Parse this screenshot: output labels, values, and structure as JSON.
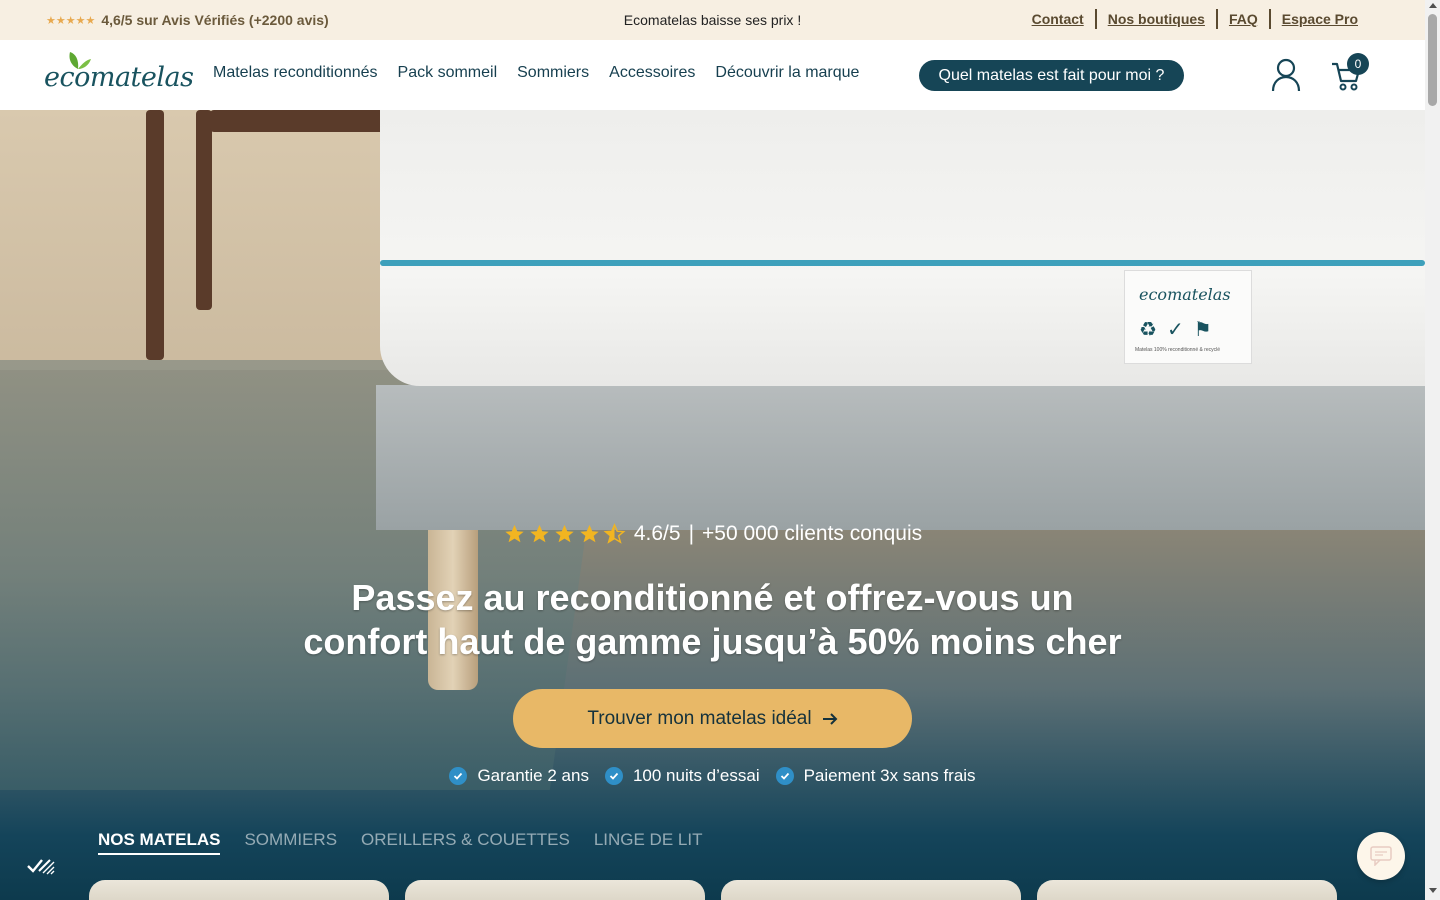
{
  "topbar": {
    "stars": "★★★★★",
    "rating_text": "4,6/5 sur Avis Vérifiés (+2200 avis)",
    "promo": "Ecomatelas baisse ses prix !",
    "links": [
      "Contact",
      "Nos boutiques",
      "FAQ",
      "Espace Pro"
    ]
  },
  "header": {
    "logo_text": "ecomatelas",
    "nav": [
      "Matelas reconditionnés",
      "Pack sommeil",
      "Sommiers",
      "Accessoires",
      "Découvrir la marque"
    ],
    "quiz_button": "Quel matelas est fait pour moi ?",
    "cart_count": "0"
  },
  "hero": {
    "mattress_label_brand": "ecomatelas",
    "mattress_label_fine": "Matelas 100% reconditionné & recyclé",
    "rating_value": "4.6/5",
    "rating_separator": "|",
    "rating_clients": "+50 000 clients conquis",
    "stars_value": 4.5,
    "title_line1": "Passez au reconditionné et offrez-vous un",
    "title_line2": "confort haut de gamme jusqu’à 50% moins cher",
    "cta": "Trouver mon matelas idéal",
    "guarantees": [
      "Garantie 2 ans",
      "100 nuits d’essai",
      "Paiement 3x sans frais"
    ]
  },
  "tabs": [
    {
      "label": "NOS MATELAS",
      "active": true
    },
    {
      "label": "SOMMIERS",
      "active": false
    },
    {
      "label": "OREILLERS & COUETTES",
      "active": false
    },
    {
      "label": "LINGE DE LIT",
      "active": false
    }
  ],
  "colors": {
    "brand_dark": "#164556",
    "accent_gold": "#e8b867",
    "check_blue": "#2f8fc7",
    "star_yellow": "#f2b521",
    "topbar_bg": "#f7efe2"
  }
}
